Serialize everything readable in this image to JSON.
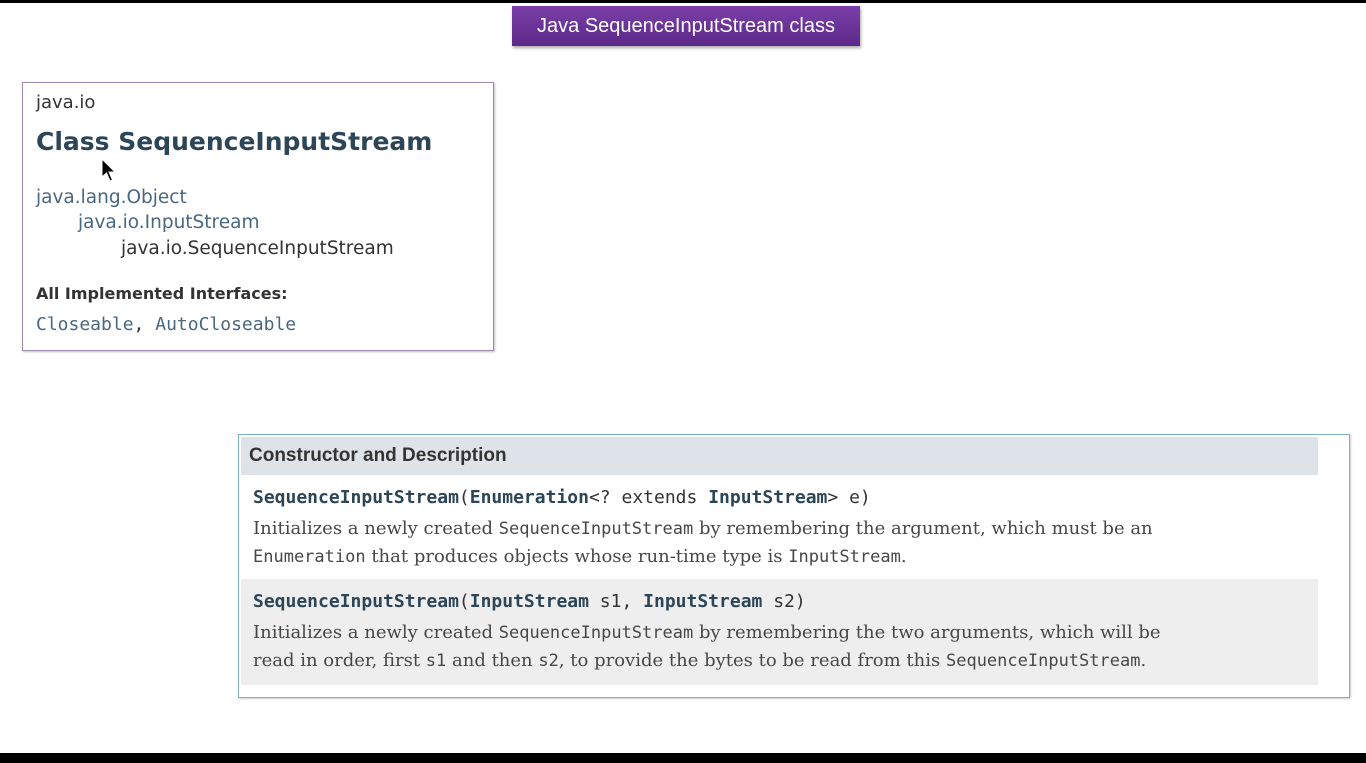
{
  "slide_title": "Java SequenceInputStream class",
  "class_doc": {
    "package": "java.io",
    "title": "Class SequenceInputStream",
    "hierarchy": [
      "java.lang.Object",
      "java.io.InputStream",
      "java.io.SequenceInputStream"
    ],
    "implemented_label": "All Implemented Interfaces:",
    "interfaces": [
      "Closeable",
      "AutoCloseable"
    ],
    "separator": ", "
  },
  "constructors": {
    "header": "Constructor and Description",
    "rows": [
      {
        "name": "SequenceInputStream",
        "param_type1": "Enumeration",
        "generic": "<? extends ",
        "param_type2": "InputStream",
        "rest": "> e)",
        "desc_line1_a": "Initializes a newly created ",
        "desc_line1_code": "SequenceInputStream",
        "desc_line1_b": " by remembering the argument, which must be an",
        "desc_line2_code1": "Enumeration",
        "desc_line2_a": " that produces objects whose run-time type is ",
        "desc_line2_code2": "InputStream",
        "desc_line2_b": "."
      },
      {
        "name": "SequenceInputStream",
        "p1_type": "InputStream",
        "p1_name": " s1, ",
        "p2_type": "InputStream",
        "p2_name": " s2)",
        "desc_line1_a": "Initializes a newly created ",
        "desc_line1_code": "SequenceInputStream",
        "desc_line1_b": " by remembering the two arguments, which will be",
        "desc_line2_a": "read in order, first ",
        "desc_line2_code1": "s1",
        "desc_line2_b": " and then ",
        "desc_line2_code2": "s2",
        "desc_line2_c": ", to provide the bytes to be read from this ",
        "desc_line2_code3": "SequenceInputStream",
        "desc_line2_d": "."
      }
    ]
  }
}
